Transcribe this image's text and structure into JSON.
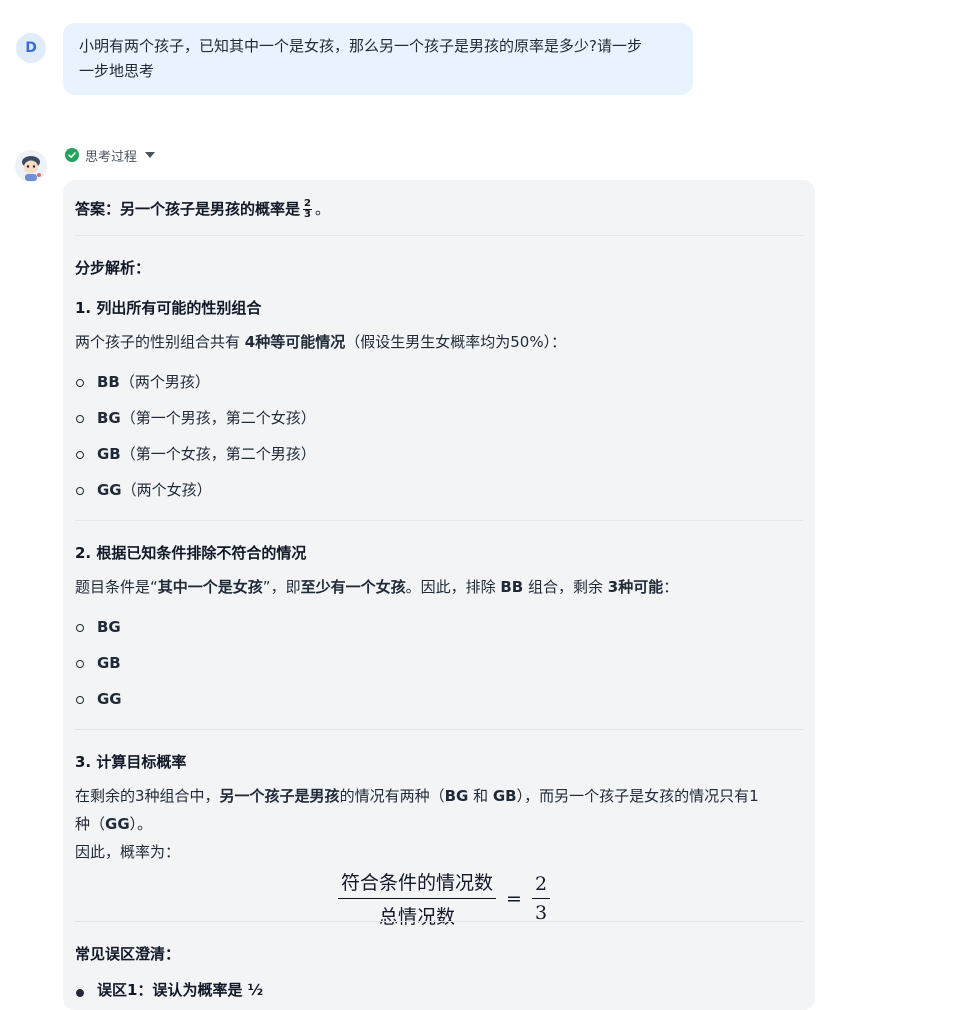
{
  "user": {
    "avatar_letter": "D",
    "question_line1": "小明有两个孩子，已知其中一个是女孩，那么另一个孩子是男孩的原率是多少?请一步",
    "question_line2": "一步地思考"
  },
  "thinking": {
    "label": "思考过程"
  },
  "answer": {
    "summary_prefix": "答案：另一个孩子是男孩的概率是",
    "summary_frac_num": "2",
    "summary_frac_den": "3",
    "summary_suffix": "。",
    "step_heading": "分步解析：",
    "s1_title": "1. 列出所有可能的性别组合",
    "s1_intro_a": "两个孩子的性别组合共有 ",
    "s1_intro_b": "4种等可能情况",
    "s1_intro_c": "（假设生男生女概率均为50%）：",
    "s1_items": [
      {
        "code": "BB",
        "desc": "（两个男孩）"
      },
      {
        "code": "BG",
        "desc": "（第一个男孩，第二个女孩）"
      },
      {
        "code": "GB",
        "desc": "（第一个女孩，第二个男孩）"
      },
      {
        "code": "GG",
        "desc": "（两个女孩）"
      }
    ],
    "s2_title": "2. 根据已知条件排除不符合的情况",
    "s2_p_a": "题目条件是“",
    "s2_p_b": "其中一个是女孩",
    "s2_p_c": "”，即",
    "s2_p_d": "至少有一个女孩",
    "s2_p_e": "。因此，排除 ",
    "s2_p_f": "BB",
    "s2_p_g": " 组合，剩余 ",
    "s2_p_h": "3种可能",
    "s2_p_i": "：",
    "s2_items": [
      "BG",
      "GB",
      "GG"
    ],
    "s3_title": "3. 计算目标概率",
    "s3_p1_a": "在剩余的3种组合中，",
    "s3_p1_b": "另一个孩子是男孩",
    "s3_p1_c": "的情况有两种（",
    "s3_p1_d": "BG",
    "s3_p1_e": " 和 ",
    "s3_p1_f": "GB",
    "s3_p1_g": "），而另一个孩子是女孩的情况只有1",
    "s3_p2_a": "种（",
    "s3_p2_b": "GG",
    "s3_p2_c": "）。",
    "s3_p3": "因此，概率为：",
    "formula_num": "符合条件的情况数",
    "formula_den": "总情况数",
    "formula_eq": "=",
    "formula_res_num": "2",
    "formula_res_den": "3",
    "misc_title": "常见误区澄清：",
    "misc_item1": "误区1：误认为概率是 ½"
  }
}
